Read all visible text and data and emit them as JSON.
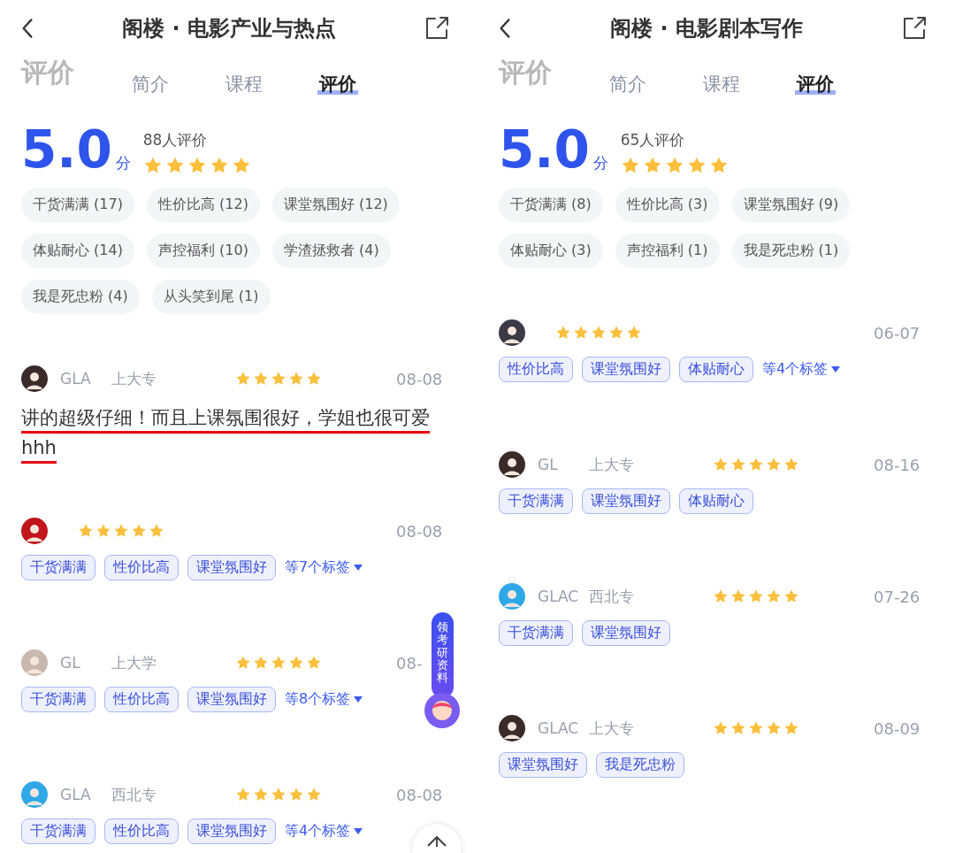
{
  "panels": [
    {
      "title": "阁楼 · 电影产业与热点",
      "ghost_title": "评价",
      "tabs": [
        {
          "label": "简介",
          "selected": false
        },
        {
          "label": "课程",
          "selected": false
        },
        {
          "label": "评价",
          "selected": true
        }
      ],
      "score": "5.0",
      "score_unit": "分",
      "rating_count": "88人评价",
      "stars": 5,
      "tag_summary": [
        "干货满满 (17)",
        "性价比高 (12)",
        "课堂氛围好 (12)",
        "体贴耐心 (14)",
        "声控福利 (10)",
        "学渣拯救者 (4)",
        "我是死忠粉 (4)",
        "从头笑到尾 (1)"
      ],
      "reviews": [
        {
          "name": "GLA",
          "school": "上大专",
          "stars": 5,
          "date": "08-08",
          "color": "#3a2a2a",
          "comment": "讲的超级仔细！而且上课氛围很好，学姐也很可爱hhh",
          "underlined": true
        },
        {
          "stars": 5,
          "date": "08-08",
          "color": "#c0151b",
          "tags": [
            "干货满满",
            "性价比高",
            "课堂氛围好"
          ],
          "more_tags": "等7个标签"
        },
        {
          "name": "GL",
          "school": "上大学",
          "stars": 5,
          "date": "08-",
          "color": "#c9b8ad",
          "tags": [
            "干货满满",
            "性价比高",
            "课堂氛围好"
          ],
          "more_tags": "等8个标签"
        },
        {
          "name": "GLA",
          "school": "西北专",
          "stars": 5,
          "date": "08-08",
          "color": "#2fa8e8",
          "tags": [
            "干货满满",
            "性价比高",
            "课堂氛围好"
          ],
          "more_tags": "等4个标签"
        }
      ],
      "floating_button": "领考研资料",
      "back_to_top": true
    },
    {
      "title": "阁楼 · 电影剧本写作",
      "ghost_title": "评价",
      "tabs": [
        {
          "label": "简介",
          "selected": false
        },
        {
          "label": "课程",
          "selected": false
        },
        {
          "label": "评价",
          "selected": true
        }
      ],
      "score": "5.0",
      "score_unit": "分",
      "rating_count": "65人评价",
      "stars": 5,
      "tag_summary": [
        "干货满满 (8)",
        "性价比高 (3)",
        "课堂氛围好 (9)",
        "体贴耐心 (3)",
        "声控福利 (1)",
        "我是死忠粉 (1)"
      ],
      "reviews": [
        {
          "stars": 5,
          "date": "06-07",
          "color": "#3b3a46",
          "tags": [
            "性价比高",
            "课堂氛围好",
            "体贴耐心"
          ],
          "more_tags": "等4个标签"
        },
        {
          "name": "GL",
          "school": "上大专",
          "stars": 5,
          "date": "08-16",
          "color": "#3a2a2a",
          "tags": [
            "干货满满",
            "课堂氛围好",
            "体贴耐心"
          ]
        },
        {
          "name": "GLAC",
          "school": "西北专",
          "stars": 5,
          "date": "07-26",
          "color": "#2fa8e8",
          "tags": [
            "干货满满",
            "课堂氛围好"
          ]
        },
        {
          "name": "GLAC",
          "school": "上大专",
          "stars": 5,
          "date": "08-09",
          "color": "#3a2a2a",
          "tags": [
            "课堂氛围好",
            "我是死忠粉"
          ]
        }
      ]
    }
  ]
}
